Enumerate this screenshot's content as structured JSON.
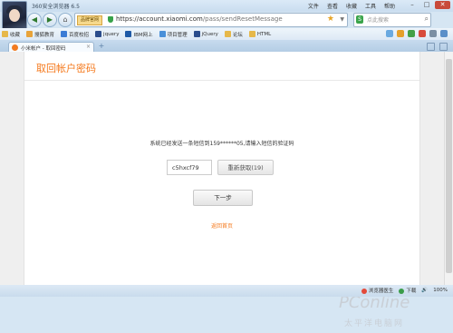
{
  "browser": {
    "title": "360安全浏览器 6.5",
    "menus": [
      "文件",
      "查看",
      "收藏",
      "工具",
      "帮助"
    ]
  },
  "navbar": {
    "mode_label": "品牌官网",
    "url_host": "https://account.xiaomi.com",
    "url_path": "/pass/sendResetMessage",
    "search_placeholder": "点此搜索"
  },
  "bookmarks": [
    {
      "label": "收藏",
      "color": "#e6b84a"
    },
    {
      "label": "搜狐教育",
      "color": "#e8a33a"
    },
    {
      "label": "百度校招",
      "color": "#3a7bd5"
    },
    {
      "label": "jquery",
      "color": "#2b4d8c"
    },
    {
      "label": "IBM网上",
      "color": "#1f5aa6"
    },
    {
      "label": "项目管理",
      "color": "#4a90d9"
    },
    {
      "label": "jQuery",
      "color": "#2b4d8c"
    },
    {
      "label": "论坛",
      "color": "#e6b84a"
    },
    {
      "label": "HTML",
      "color": "#e6b84a"
    }
  ],
  "tab": {
    "title": "小米帐户 - 取回密码"
  },
  "page": {
    "heading": "取回帐户密码",
    "message": "系统已经发送一条短信到159******05,请输入短信的验证码",
    "code_value": "c5hxcf79",
    "resend_label": "重新获取(19)",
    "next_label": "下一步",
    "back_label": "返回首页"
  },
  "watermark": {
    "brand": "PConline",
    "site": "太平洋电脑网"
  },
  "statusbar": {
    "items": [
      "浏览器医生",
      "下载"
    ],
    "zoom": "100%"
  },
  "colors": {
    "accent": "#f57a1e",
    "chrome": "#d6e6f3"
  }
}
